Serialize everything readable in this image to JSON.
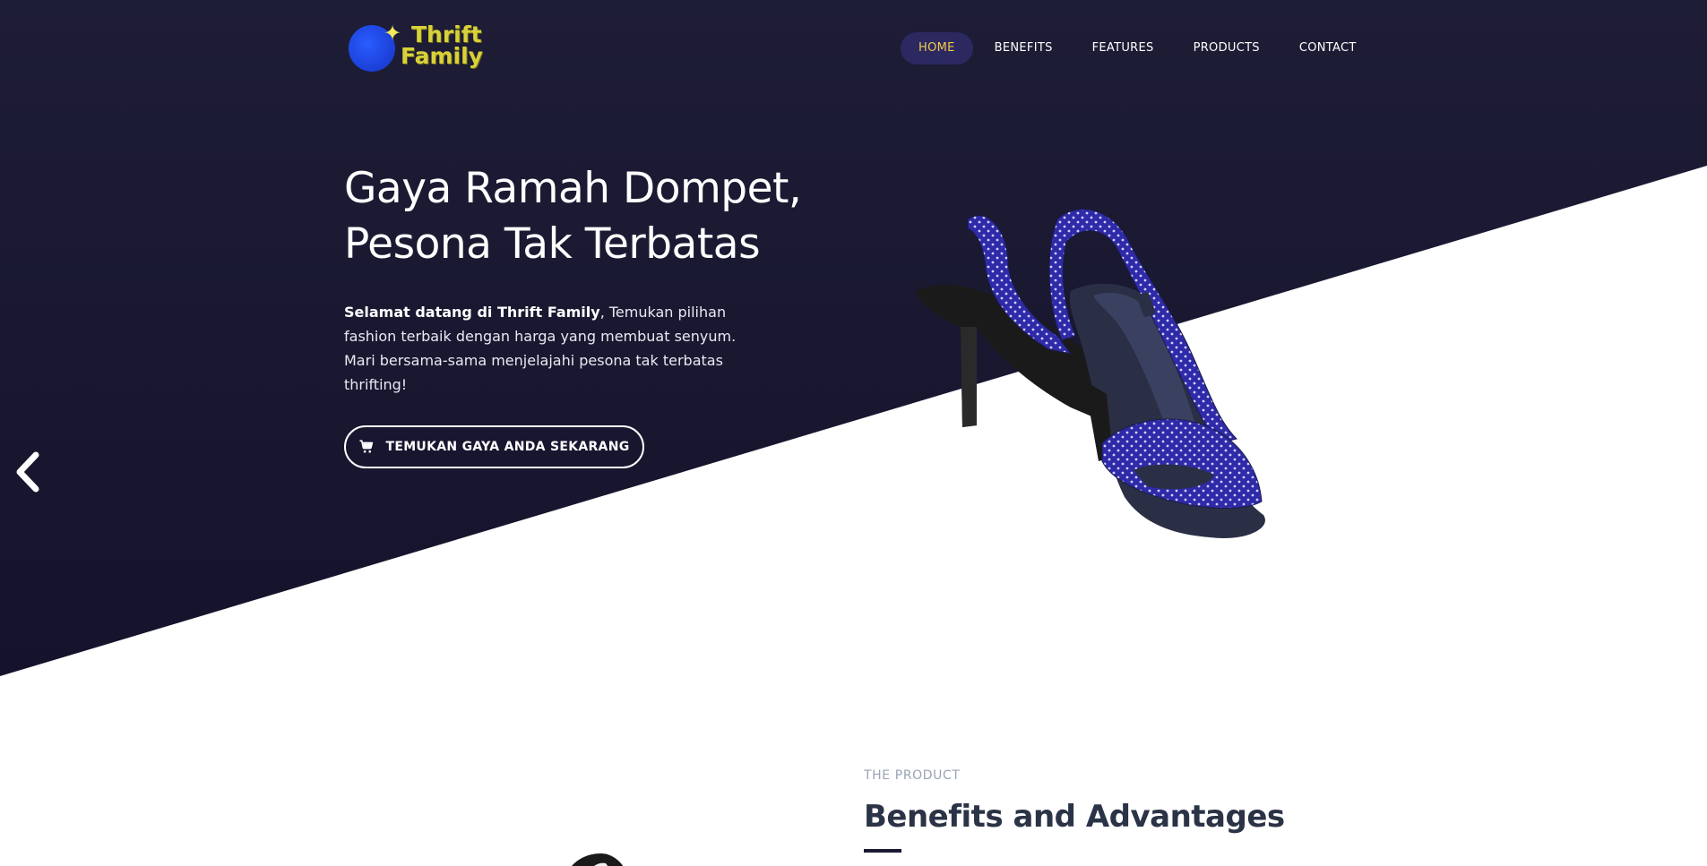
{
  "brand": {
    "logo_line1": "Thrift",
    "logo_line2": "Family",
    "logo_icon": "star-moon-icon"
  },
  "nav": {
    "items": [
      {
        "label": "HOME",
        "active": true
      },
      {
        "label": "BENEFITS",
        "active": false
      },
      {
        "label": "FEATURES",
        "active": false
      },
      {
        "label": "PRODUCTS",
        "active": false
      },
      {
        "label": "CONTACT",
        "active": false
      }
    ]
  },
  "hero": {
    "title_line1": "Gaya Ramah Dompet,",
    "title_line2": "Pesona Tak Terbatas",
    "desc_bold": "Selamat datang di Thrift Family",
    "desc_rest": ", Temukan pilihan fashion terbaik dengan harga yang membuat senyum. Mari bersama-sama menjelajahi pesona tak terbatas thrifting!",
    "cta_label": "TEMUKAN GAYA ANDA SEKARANG",
    "cta_icon": "cart-icon",
    "prev_icon": "chevron-left-icon"
  },
  "section": {
    "eyebrow": "THE PRODUCT",
    "title": "Benefits and Advantages"
  },
  "colors": {
    "hero_bg": "#1b1a33",
    "nav_active_bg": "#2b2960",
    "nav_active_text": "#f2c94c",
    "shoe_fabric": "#2f2aa8",
    "logo_text": "#d9d13a",
    "logo_circle": "#1b3fd6"
  }
}
